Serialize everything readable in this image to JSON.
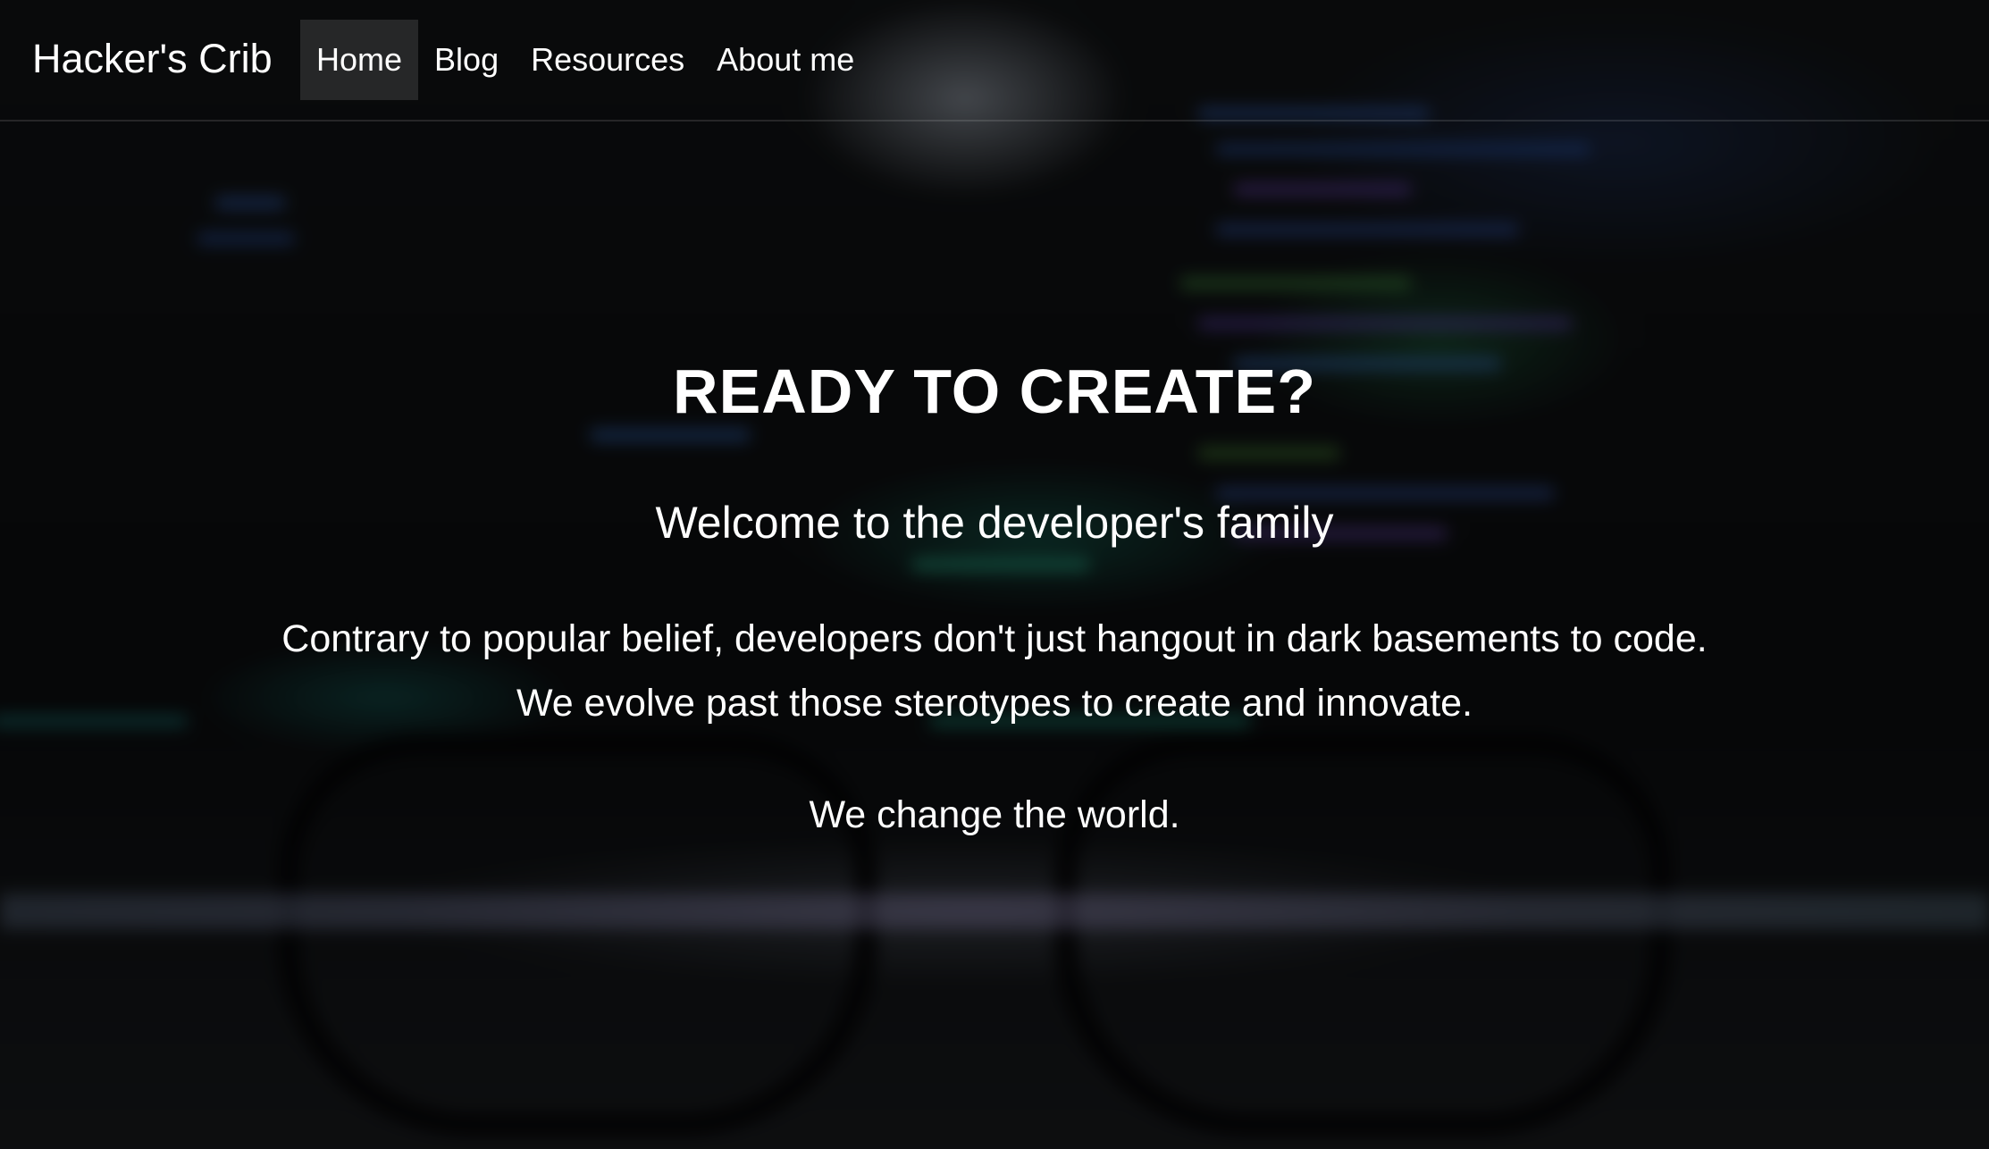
{
  "navbar": {
    "brand": "Hacker's Crib",
    "items": [
      {
        "label": "Home",
        "active": true
      },
      {
        "label": "Blog",
        "active": false
      },
      {
        "label": "Resources",
        "active": false
      },
      {
        "label": "About me",
        "active": false
      }
    ]
  },
  "hero": {
    "title": "READY TO CREATE?",
    "subtitle": "Welcome to the developer's family",
    "line1": "Contrary to popular belief, developers don't just hangout in dark basements to code.",
    "line2": "We evolve past those sterotypes to create and innovate.",
    "line3": "We change the world."
  },
  "colors": {
    "text": "#ffffff",
    "overlay": "#000000",
    "active_nav_bg": "#3a3b3d"
  }
}
